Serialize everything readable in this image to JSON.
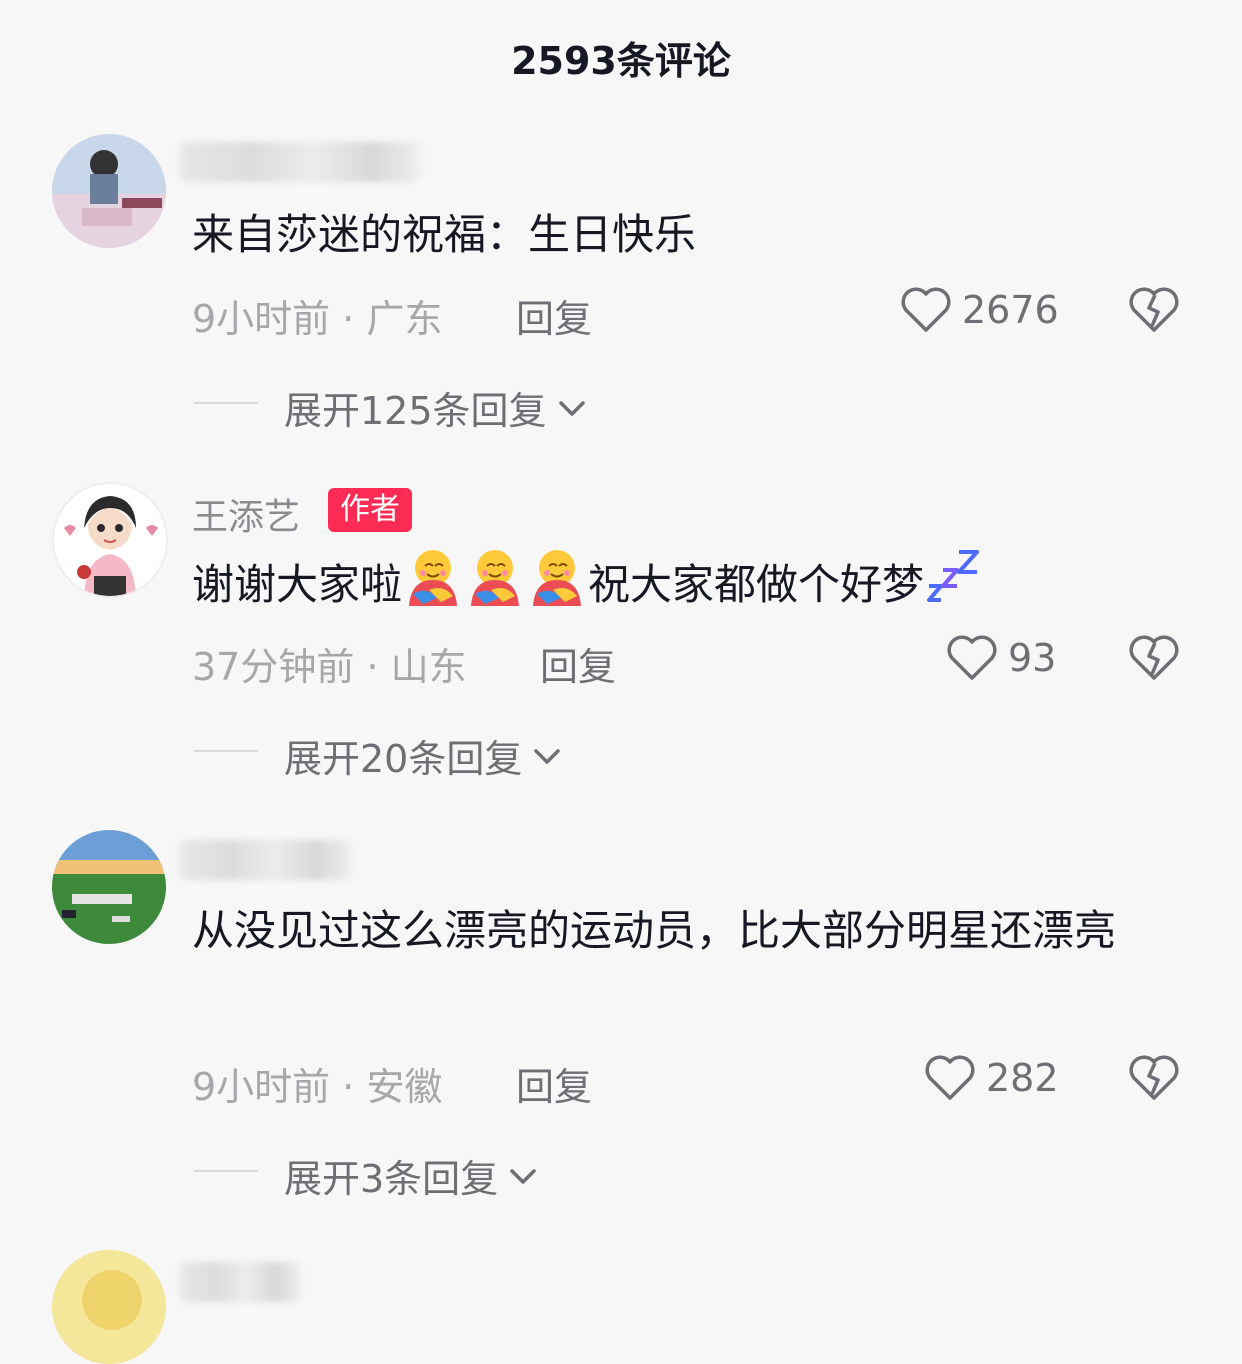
{
  "header": {
    "title": "2593条评论"
  },
  "comments": [
    {
      "text": "来自莎迷的祝福：生日快乐",
      "time": "9小时前",
      "location": "广东",
      "reply_label": "回复",
      "likes": "2676",
      "expand_label": "展开125条回复"
    },
    {
      "name": "王添艺",
      "badge": "作者",
      "text_a": "谢谢大家啦",
      "text_b": "祝大家都做个好梦",
      "time": "37分钟前",
      "location": "山东",
      "reply_label": "回复",
      "likes": "93",
      "expand_label": "展开20条回复"
    },
    {
      "text": "从没见过这么漂亮的运动员，比大部分明星还漂亮",
      "time": "9小时前",
      "location": "安徽",
      "reply_label": "回复",
      "likes": "282",
      "expand_label": "展开3条回复"
    }
  ],
  "icons": {
    "like": "heart-outline-icon",
    "dislike": "broken-heart-icon",
    "expand": "chevron-down-icon"
  },
  "colors": {
    "author_badge": "#fe2c55",
    "background": "#f7f7f7"
  }
}
